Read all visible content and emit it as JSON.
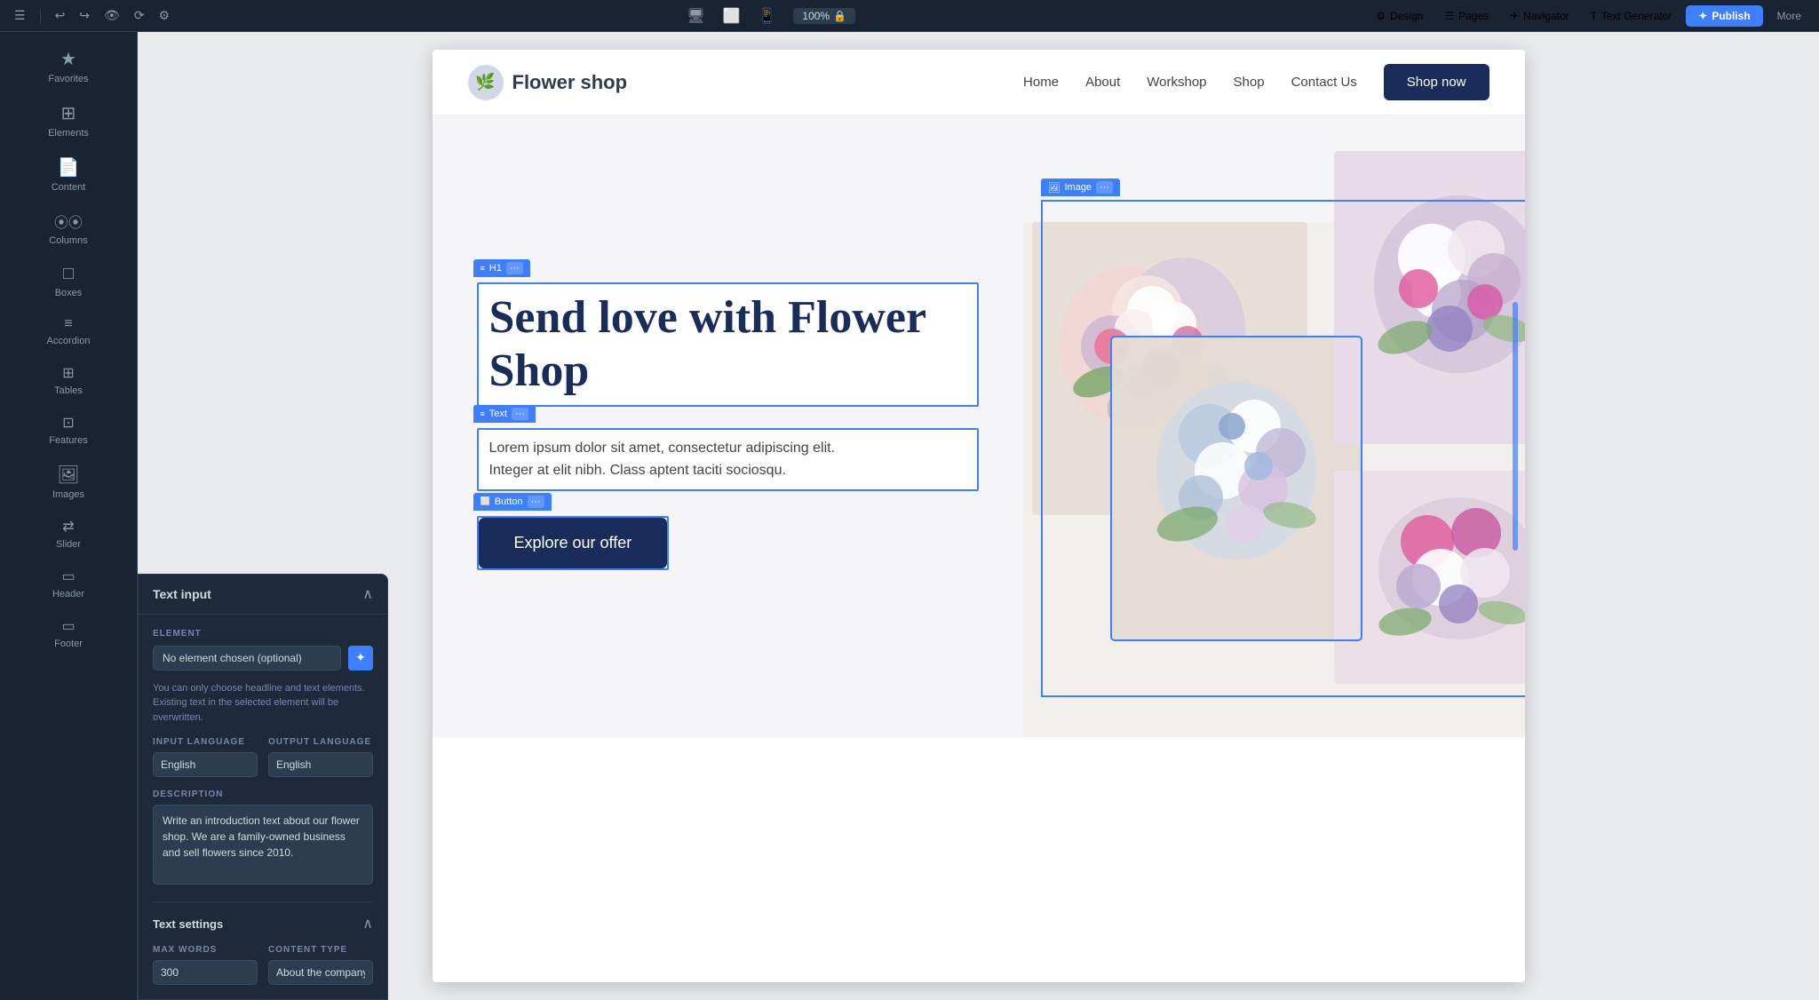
{
  "toolbar": {
    "undo_icon": "↩",
    "redo_icon": "↪",
    "eye_icon": "👁",
    "refresh_icon": "⟳",
    "settings_icon": "⚙",
    "desktop_icon": "🖥",
    "tablet_icon": "⬜",
    "mobile_icon": "📱",
    "zoom_label": "100%",
    "lock_icon": "🔒",
    "design_label": "Design",
    "pages_label": "Pages",
    "navigator_label": "Navigator",
    "text_gen_label": "Text Generator",
    "publish_label": "Publish",
    "more_label": "More"
  },
  "sidebar": {
    "items": [
      {
        "id": "favorites",
        "icon": "★",
        "label": "Favorites"
      },
      {
        "id": "elements",
        "icon": "⊞",
        "label": "Elements"
      },
      {
        "id": "content",
        "icon": "📄",
        "label": "Content"
      },
      {
        "id": "columns",
        "icon": "⋮⋮",
        "label": "Columns"
      },
      {
        "id": "boxes",
        "icon": "□",
        "label": "Boxes"
      },
      {
        "id": "accordion",
        "icon": "☰",
        "label": "Accordion"
      },
      {
        "id": "tables",
        "icon": "⊞",
        "label": "Tables"
      },
      {
        "id": "features",
        "icon": "⊡",
        "label": "Features"
      },
      {
        "id": "images",
        "icon": "🖼",
        "label": "Images"
      },
      {
        "id": "slider",
        "icon": "⇄",
        "label": "Slider"
      },
      {
        "id": "header",
        "icon": "⊟",
        "label": "Header"
      },
      {
        "id": "footer",
        "icon": "⊟",
        "label": "Footer"
      }
    ]
  },
  "website": {
    "logo_icon": "🌿",
    "logo_text": "Flower shop",
    "nav_items": [
      "Home",
      "About",
      "Workshop",
      "Shop",
      "Contact Us"
    ],
    "cta_button": "Shop now",
    "hero": {
      "h1_tag": "H1",
      "h1_text": "Send love with Flower Shop",
      "text_tag": "Text",
      "text_content": "Lorem ipsum dolor sit amet, consectetur adipiscing elit. Integer at elit nibh. Class aptent taciti sociosqu.",
      "button_tag": "Button",
      "button_text": "Explore our offer",
      "image_tag": "Image"
    }
  },
  "bottom_panel": {
    "title": "Text input",
    "close_icon": "∧",
    "element_section": {
      "label": "ELEMENT",
      "placeholder": "No element chosen (optional)",
      "description": "You can only choose headline and text elements. Existing text in the selected element will be overwritten."
    },
    "input_language_label": "INPUT LANGUAGE",
    "output_language_label": "OUTPUT LANGUAGE",
    "input_language_value": "English",
    "output_language_value": "English",
    "description_label": "DESCRIPTION",
    "description_value": "Write an introduction text about our flower shop. We are a family-owned business and sell flowers since 2010.",
    "text_settings": {
      "title": "Text settings",
      "collapse_icon": "∧",
      "max_words_label": "MAX WORDS",
      "max_words_value": "300",
      "content_type_label": "CONTENT TYPE",
      "content_type_value": "About the company"
    }
  }
}
